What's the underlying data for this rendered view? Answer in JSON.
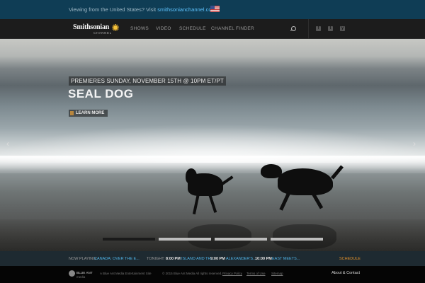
{
  "geo_banner": {
    "text": "Viewing from the United States? Visit",
    "link": "smithsonianchannel.com"
  },
  "nav": {
    "logo_name": "Smithsonian",
    "logo_sub": "CHANNEL",
    "items": [
      "SHOWS",
      "VIDEO",
      "SCHEDULE",
      "CHANNEL FINDER"
    ],
    "social": [
      "f",
      "t",
      "y"
    ]
  },
  "hero": {
    "premiere": "PREMIERES SUNDAY, NOVEMBER 15TH @ 10PM ET/PT",
    "title": "SEAL DOG",
    "cta": "LEARN MORE",
    "prev": "‹",
    "next": "›",
    "active_slide": 0,
    "slide_count": 4
  },
  "now_playing": {
    "label": "NOW PLAYING:",
    "current": "CANADA: OVER THE E...",
    "tonight_label": "TONIGHT:",
    "schedule": [
      {
        "time": "8:00 PM",
        "show": "ISLAND AND TH..."
      },
      {
        "time": "9:00 PM",
        "show": "ALEXANDER'S..."
      },
      {
        "time": "10:00 PM",
        "show": "EAST MEETS..."
      }
    ],
    "schedule_link": "SCHEDULE"
  },
  "footer": {
    "logo_text": "BLUE ANT",
    "logo_sub": "media",
    "company": "A Blue Ant Media Entertainment Site",
    "copyright": "© 2015 Blue Ant Media All rights reserved.",
    "links": [
      "Privacy Policy",
      "Terms of Use",
      "Sitemap"
    ],
    "about": "About & Contact"
  }
}
